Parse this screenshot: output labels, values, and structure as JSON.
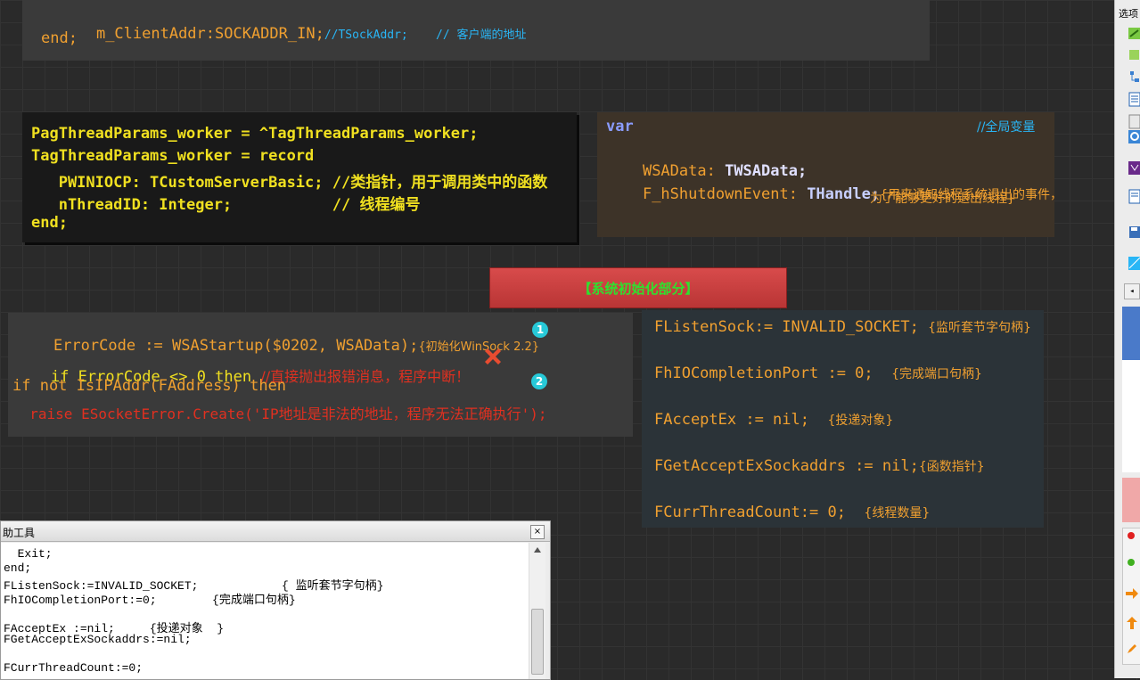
{
  "top_block": {
    "line1": "m_ClientAddr:SOCKADDR_IN;",
    "line1_comment": "//TSockAddr;    // 客户端的地址",
    "line2": "end;"
  },
  "record_block": {
    "lines": [
      "PagThreadParams_worker = ^TagThreadParams_worker;",
      "TagThreadParams_worker = record",
      "   PWINIOCP: TCustomServerBasic; //类指针，用于调用类中的函数",
      "   nThreadID: Integer;           // 线程编号",
      "end;"
    ]
  },
  "global_vars": {
    "keyword": "var",
    "comment": "//全局变量",
    "wsadata_name": "WSAData: ",
    "wsadata_type": "TWSAData;",
    "shutdown_name": "F_hShutdownEvent: ",
    "shutdown_type": "THandle;",
    "shutdown_comment1": "{用来通知线程系统退出的事件，",
    "shutdown_comment2": "为了能够更好的退出线程}"
  },
  "init_header": "【系统初始化部分】",
  "error_block": {
    "line1_code": "ErrorCode := WSAStartup($0202, WSAData);",
    "line1_comment": "{初始化WinSock 2.2}",
    "line2_code": "if ErrorCode <> 0 then ",
    "line2_comment": "//直接抛出报错消息，程序中断！",
    "line3": "if not IsIPAddr(FAddress) then",
    "line4": "  raise ESocketError.Create('IP地址是非法的地址，程序无法正确执行');",
    "badge1": "1",
    "badge2": "2"
  },
  "init_vars": {
    "lines": [
      {
        "code": "FListenSock:= INVALID_SOCKET;",
        "comment": "{监听套节字句柄}"
      },
      {
        "code": "FhIOCompletionPort := 0;",
        "comment": "{完成端口句柄}"
      },
      {
        "code": "FAcceptEx := nil;",
        "comment": "{投递对象}"
      },
      {
        "code": "FGetAcceptExSockaddrs := nil;",
        "comment": "{函数指针}"
      },
      {
        "code": "FCurrThreadCount:= 0;",
        "comment": "{线程数量}"
      }
    ]
  },
  "helper_window": {
    "title": "助工具",
    "close": "×",
    "lines": [
      "  Exit;",
      "end;",
      "FListenSock:=INVALID_SOCKET;            { 监听套节字句柄}",
      "FhIOCompletionPort:=0;        {完成端口句柄}",
      "",
      "FAcceptEx :=nil;     {投递对象  }",
      "FGetAcceptExSockaddrs:=nil;",
      "",
      "FCurrThreadCount:=0;"
    ]
  },
  "toolbar": {
    "title": "选项"
  },
  "colors": {
    "background": "#2a2a2a",
    "record_text": "#f0e020",
    "comment_cyan": "#29b6f6",
    "error_red": "#e03020",
    "init_header_bg": "#c83e3e",
    "init_header_text": "#2fe02f",
    "var_blue": "#8a9cff",
    "orange": "#f0a030"
  }
}
